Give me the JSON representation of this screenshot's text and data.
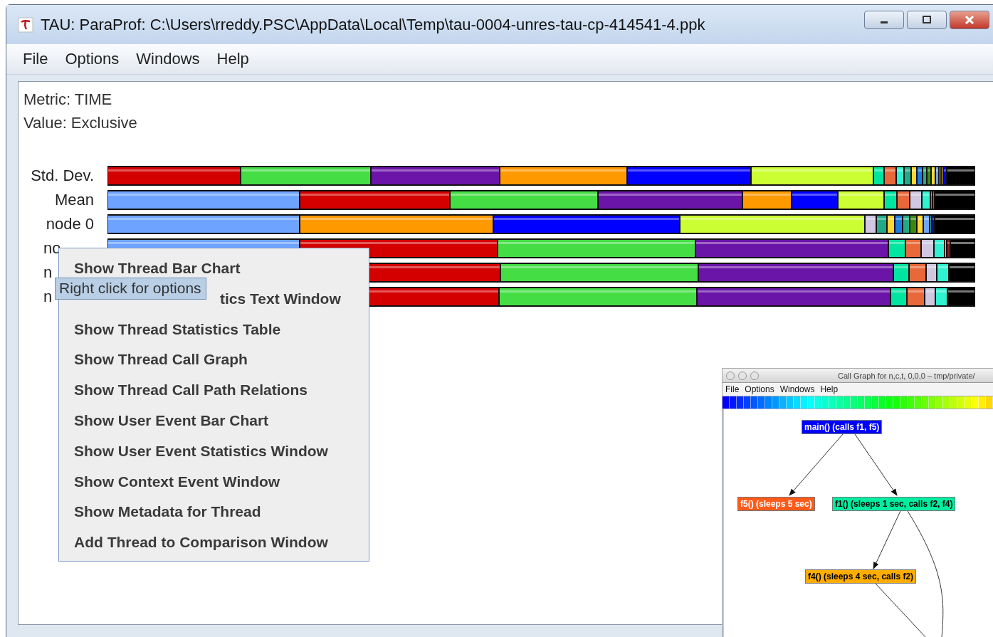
{
  "window": {
    "title": "TAU: ParaProf: C:\\Users\\rreddy.PSC\\AppData\\Local\\Temp\\tau-0004-unres-tau-cp-414541-4.ppk"
  },
  "menu": [
    "File",
    "Options",
    "Windows",
    "Help"
  ],
  "info": [
    "Metric: TIME",
    "Value: Exclusive"
  ],
  "rows": [
    {
      "label": "Std. Dev.",
      "kind": "full"
    },
    {
      "label": "Mean",
      "kind": "full"
    },
    {
      "label": "node 0",
      "kind": "full"
    },
    {
      "label": "no",
      "kind": "covered"
    },
    {
      "label": "n",
      "kind": "covered"
    },
    {
      "label": "n",
      "kind": "covered"
    }
  ],
  "context_menu": {
    "items": [
      {
        "label": "Show Thread Bar Chart",
        "kind": "full"
      },
      {
        "label": "tics Text Window",
        "kind": "covered"
      },
      {
        "label": "Show Thread Statistics Table",
        "kind": "full"
      },
      {
        "label": "Show Thread Call Graph",
        "kind": "full"
      },
      {
        "label": "Show Thread Call Path Relations",
        "kind": "full"
      },
      {
        "label": "Show User Event Bar Chart",
        "kind": "full"
      },
      {
        "label": "Show User Event Statistics Window",
        "kind": "full"
      },
      {
        "label": "Show Context Event Window",
        "kind": "full"
      },
      {
        "label": "Show Metadata for Thread",
        "kind": "full"
      },
      {
        "label": "Add Thread to Comparison Window",
        "kind": "full"
      }
    ]
  },
  "tooltip": "Right click for options",
  "call_graph_window": {
    "title": "Call Graph for n,c,t, 0,0,0 – tmp/private/",
    "menu": [
      "File",
      "Options",
      "Windows",
      "Help"
    ],
    "nodes": [
      {
        "label": "main() (calls f1, f5)",
        "color": "#0000ff"
      },
      {
        "label": "f5() (sleeps 5 sec)",
        "color": "#ff5a1a"
      },
      {
        "label": "f1() (sleeps 1 sec, calls f2, f4)",
        "color": "#00eea0"
      },
      {
        "label": "f4() (sleeps 4 sec, calls f2)",
        "color": "#ffae00"
      }
    ]
  }
}
